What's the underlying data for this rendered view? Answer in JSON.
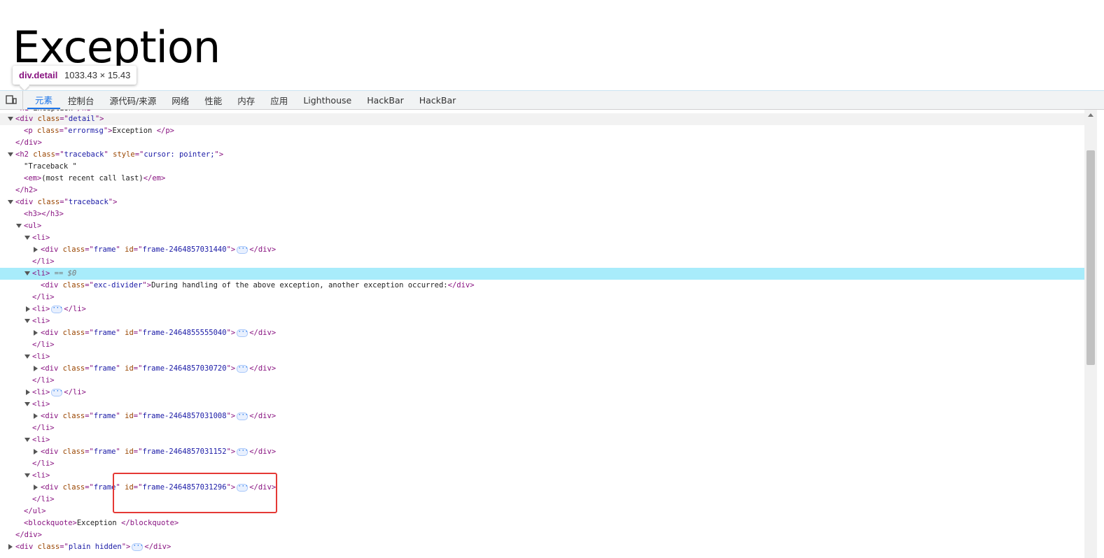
{
  "page": {
    "heading": "Exception",
    "inspect_tooltip": {
      "tag": "div.detail",
      "size": "1033.43 × 15.43"
    }
  },
  "devtools": {
    "tabs": [
      "元素",
      "控制台",
      "源代码/来源",
      "网络",
      "性能",
      "内存",
      "应用",
      "Lighthouse",
      "HackBar",
      "HackBar"
    ],
    "active_tab": "元素",
    "accent_color": "#1a73e8",
    "selected_row_color": "#a8ecfb",
    "annotation_color": "#e53935",
    "dom": {
      "l0": {
        "a": "<div ",
        "b": "class",
        "c": "=\"",
        "d": "detail",
        "e": "\">"
      },
      "l1": {
        "a": "<p ",
        "b": "class",
        "c": "=\"",
        "d": "errormsg",
        "e": "\">",
        "f": "Exception ",
        "g": "</p>"
      },
      "l2": {
        "a": "</div>"
      },
      "l3": {
        "a": "<h2 ",
        "b": "class",
        "c": "=\"",
        "d": "traceback",
        "e": "\" ",
        "f": "style",
        "g": "=\"",
        "h": "cursor: pointer;",
        "i": "\">"
      },
      "l4": {
        "a": "\"Traceback \""
      },
      "l5": {
        "a": "<em>",
        "b": "(most recent call last)",
        "c": "</em>"
      },
      "l6": {
        "a": "</h2>"
      },
      "l7": {
        "a": "<div ",
        "b": "class",
        "c": "=\"",
        "d": "traceback",
        "e": "\">"
      },
      "l8": {
        "a": "<h3></h3>"
      },
      "l9": {
        "a": "<ul>"
      },
      "l10": {
        "a": "<li>"
      },
      "l11": {
        "a": "<div ",
        "b": "class",
        "c": "=\"",
        "d": "frame",
        "e": "\" ",
        "f": "id",
        "g": "=\"",
        "h": "frame-2464857031440",
        "i": "\">",
        "j": "</div>"
      },
      "l12": {
        "a": "</li>"
      },
      "l13": {
        "a": "<li>",
        "b": " == $0"
      },
      "l14": {
        "a": "<div ",
        "b": "class",
        "c": "=\"",
        "d": "exc-divider",
        "e": "\">",
        "f": "During handling of the above exception, another exception occurred:",
        "g": "</div>"
      },
      "l15": {
        "a": "</li>"
      },
      "l16": {
        "a": "<li>",
        "b": "</li>"
      },
      "l17": {
        "a": "<li>"
      },
      "l18": {
        "a": "<div ",
        "b": "class",
        "c": "=\"",
        "d": "frame",
        "e": "\" ",
        "f": "id",
        "g": "=\"",
        "h": "frame-2464855555040",
        "i": "\">",
        "j": "</div>"
      },
      "l19": {
        "a": "</li>"
      },
      "l20": {
        "a": "<li>"
      },
      "l21": {
        "a": "<div ",
        "b": "class",
        "c": "=\"",
        "d": "frame",
        "e": "\" ",
        "f": "id",
        "g": "=\"",
        "h": "frame-2464857030720",
        "i": "\">",
        "j": "</div>"
      },
      "l22": {
        "a": "</li>"
      },
      "l23": {
        "a": "<li>",
        "b": "</li>"
      },
      "l24": {
        "a": "<li>"
      },
      "l25": {
        "a": "<div ",
        "b": "class",
        "c": "=\"",
        "d": "frame",
        "e": "\" ",
        "f": "id",
        "g": "=\"",
        "h": "frame-2464857031008",
        "i": "\">",
        "j": "</div>"
      },
      "l26": {
        "a": "</li>"
      },
      "l27": {
        "a": "<li>"
      },
      "l28": {
        "a": "<div ",
        "b": "class",
        "c": "=\"",
        "d": "frame",
        "e": "\" ",
        "f": "id",
        "g": "=\"",
        "h": "frame-2464857031152",
        "i": "\">",
        "j": "</div>"
      },
      "l29": {
        "a": "</li>"
      },
      "l30": {
        "a": "<li>"
      },
      "l31": {
        "a": "<div ",
        "b": "class",
        "c": "=\"",
        "d": "frame",
        "e": "\" ",
        "f": "id",
        "g": "=\"",
        "h": "frame-2464857031296",
        "i": "\">",
        "j": "</div>"
      },
      "l32": {
        "a": "</li>"
      },
      "l33": {
        "a": "</ul>"
      },
      "l34": {
        "a": "<blockquote>",
        "b": "Exception ",
        "c": "</blockquote>"
      },
      "l35": {
        "a": "</div>"
      },
      "l36": {
        "a": "<div ",
        "b": "class",
        "c": "=\"",
        "d": "plain hidden",
        "e": "\">",
        "f": "</div>"
      }
    }
  }
}
